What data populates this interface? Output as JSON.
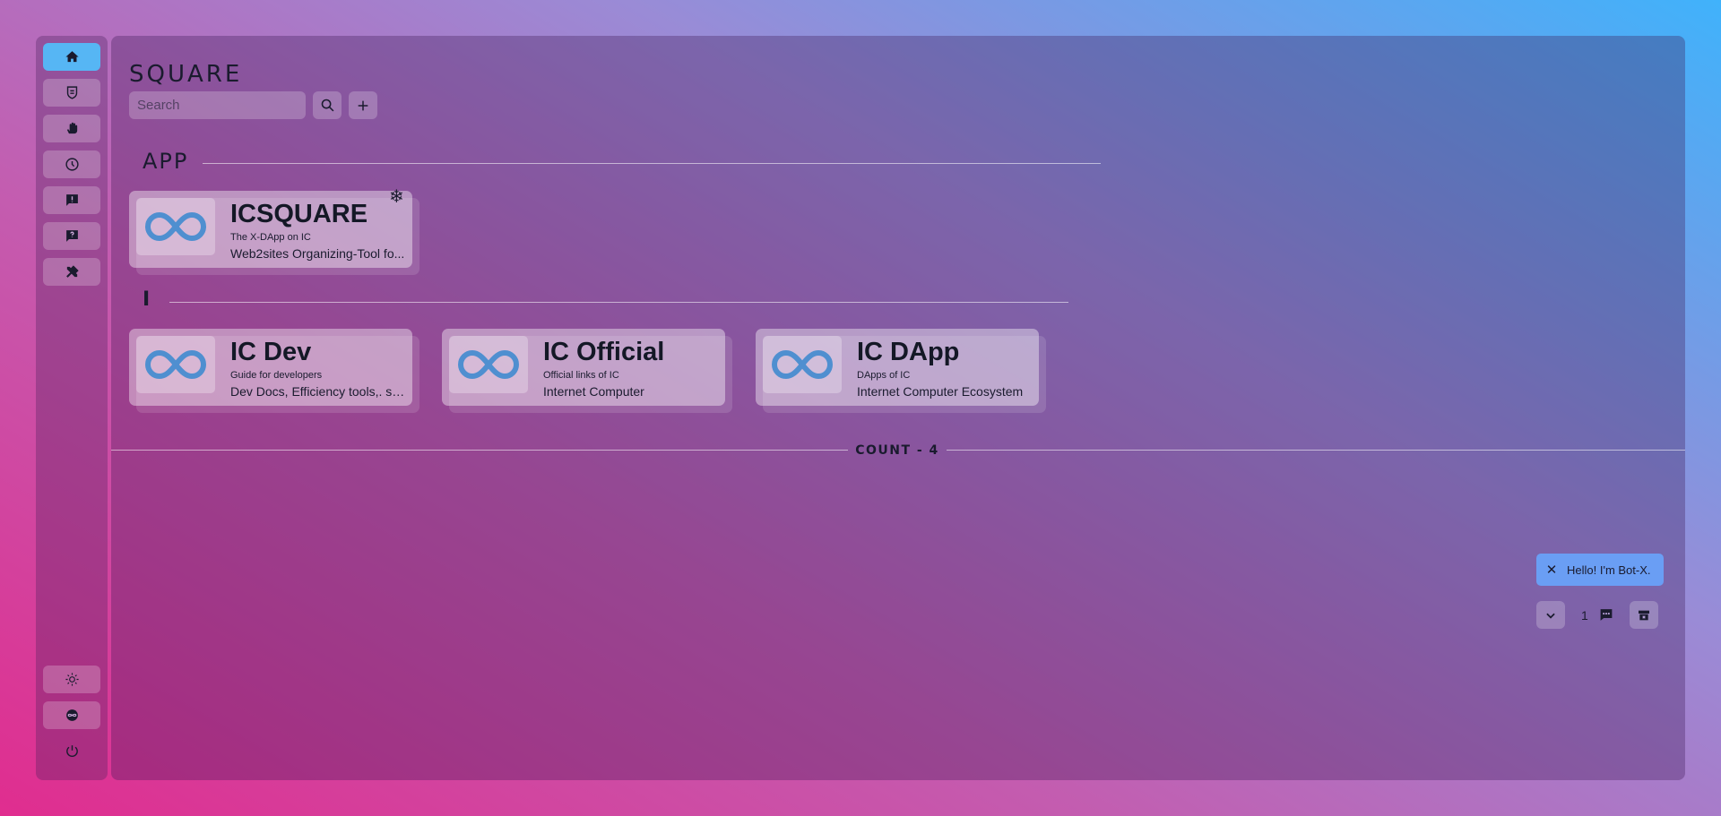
{
  "app": {
    "logo_text": "SQUARE"
  },
  "sidebar": {
    "items": [
      {
        "name": "home",
        "icon": "home-icon"
      },
      {
        "name": "shield",
        "icon": "shield-icon"
      },
      {
        "name": "hand",
        "icon": "hand-icon"
      },
      {
        "name": "history",
        "icon": "clock-icon"
      },
      {
        "name": "feedback",
        "icon": "alert-message-icon"
      },
      {
        "name": "help",
        "icon": "help-message-icon"
      },
      {
        "name": "tools",
        "icon": "tools-icon"
      }
    ],
    "bottom": [
      {
        "name": "theme",
        "icon": "sun-icon"
      },
      {
        "name": "ic",
        "icon": "infinity-icon"
      },
      {
        "name": "logout",
        "icon": "power-icon"
      }
    ]
  },
  "search": {
    "placeholder": "Search"
  },
  "sections": [
    {
      "title": "APP"
    },
    {
      "title": "I"
    }
  ],
  "cards": [
    {
      "title": "ICSQUARE",
      "subtitle": "The X-DApp on IC",
      "description": "Web2sites Organizing-Tool fo...",
      "pinned_icon": "❄"
    },
    {
      "title": "IC Dev",
      "subtitle": "Guide for developers",
      "description": "Dev Docs, Efficiency tools,. sp..."
    },
    {
      "title": "IC Official",
      "subtitle": "Official links of IC",
      "description": "Internet Computer"
    },
    {
      "title": "IC DApp",
      "subtitle": "DApps of IC",
      "description": "Internet Computer Ecosystem"
    }
  ],
  "count_label": "COUNT - 4",
  "bot": {
    "greeting": "Hello! I'm Bot-X.",
    "message_count": "1"
  },
  "colors": {
    "accent": "#56b6f4",
    "bot_bubble": "#6a9ef4",
    "text": "#1a1b2e",
    "infinity": "#4f8fd0"
  }
}
